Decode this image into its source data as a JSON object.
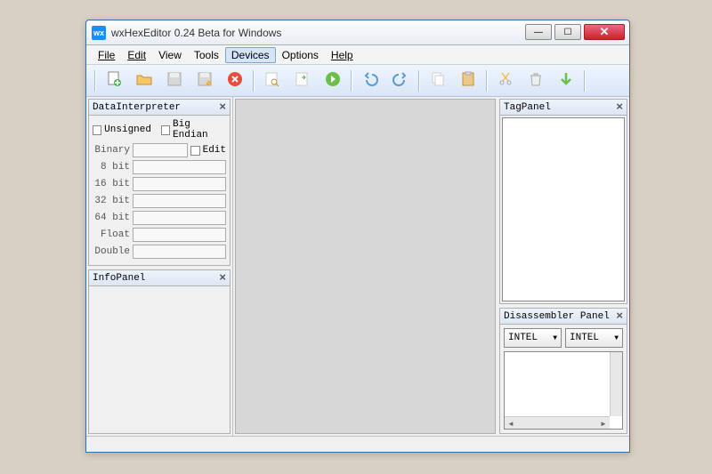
{
  "window": {
    "title": "wxHexEditor 0.24 Beta for Windows",
    "app_icon_text": "wx"
  },
  "win_controls": {
    "min": "—",
    "max": "☐",
    "close": "✕"
  },
  "menu": {
    "file": "File",
    "edit": "Edit",
    "view": "View",
    "tools": "Tools",
    "devices": "Devices",
    "options": "Options",
    "help": "Help"
  },
  "panels": {
    "data_interpreter": {
      "title": "DataInterpreter",
      "unsigned": "Unsigned",
      "big_endian": "Big Endian",
      "binary": "Binary",
      "edit": "Edit",
      "bit8": "8 bit",
      "bit16": "16 bit",
      "bit32": "32 bit",
      "bit64": "64 bit",
      "float": "Float",
      "double": "Double"
    },
    "info": {
      "title": "InfoPanel"
    },
    "tag": {
      "title": "TagPanel"
    },
    "disassembler": {
      "title": "Disassembler Panel",
      "arch": "INTEL",
      "syntax": "INTEL"
    }
  },
  "close_glyph": "×"
}
